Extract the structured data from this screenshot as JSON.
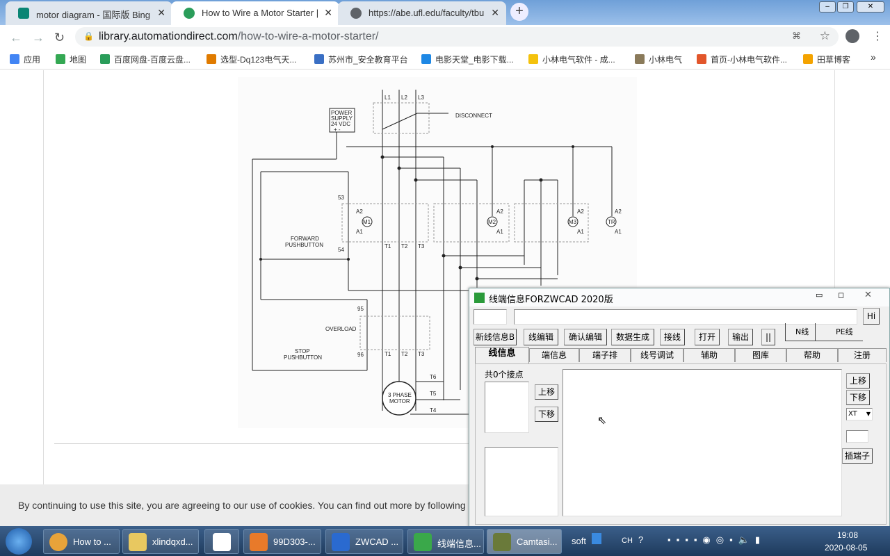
{
  "browser": {
    "tabs": [
      {
        "label": "motor diagram - 国际版 Bing",
        "icon": "bing-icon",
        "color": "#0a8574"
      },
      {
        "label": "How to Wire a Motor Starter |",
        "icon": "automationdirect-icon",
        "color": "#2a9d5a"
      },
      {
        "label": "https://abe.ufl.edu/faculty/tbu",
        "icon": "globe-icon",
        "color": "#5f6368"
      }
    ],
    "url_host": "library.automationdirect.com",
    "url_path": "/how-to-wire-a-motor-starter/",
    "bookmarks": [
      {
        "label": "应用",
        "color": "#4285f4"
      },
      {
        "label": "地图",
        "color": "#34a853"
      },
      {
        "label": "百度网盘-百度云盘...",
        "color": "#2a9d5a"
      },
      {
        "label": "选型-Dq123电气天...",
        "color": "#e07b00"
      },
      {
        "label": "苏州市_安全教育平台",
        "color": "#3a6fc4"
      },
      {
        "label": "电影天堂_电影下载...",
        "color": "#1e88e5"
      },
      {
        "label": "小林电气软件 - 成...",
        "color": "#f4c20d"
      },
      {
        "label": "小林电气",
        "color": "#8a7a5a"
      },
      {
        "label": "首页-小林电气软件...",
        "color": "#e2562b"
      },
      {
        "label": "田草博客",
        "color": "#f4a300"
      }
    ]
  },
  "diagram": {
    "phases": [
      "L1",
      "L2",
      "L3"
    ],
    "disconnect": "DISCONNECT",
    "power_supply": [
      "POWER",
      "SUPPLY",
      "24  VDC",
      "+   -"
    ],
    "n53": "53",
    "n54": "54",
    "n95": "95",
    "n96": "96",
    "a2": "A2",
    "a1": "A1",
    "coils": [
      "M1",
      "M2",
      "M3",
      "TR"
    ],
    "terminals": [
      "T1",
      "T2",
      "T3"
    ],
    "forward": [
      "FORWARD",
      "PUSHBUTTON"
    ],
    "stop": [
      "STOP",
      "PUSHBUTTON"
    ],
    "overload": "OVERLOAD",
    "motor": [
      "3 PHASE",
      "MOTOR"
    ],
    "motor_leads": [
      "T6",
      "T5",
      "T4"
    ]
  },
  "cookie_text": "By continuing to use this site, you are agreeing to our use of cookies. You can find out more by following",
  "dialog": {
    "title": "线端信息FORZWCAD 2020版",
    "hi": "Hi",
    "buttons": [
      "新线信息B",
      "线编辑",
      "确认编辑",
      "数据生成",
      "接线",
      "打开",
      "输出",
      "||"
    ],
    "n_label": "N线",
    "pe_label": "PE线",
    "tabs": [
      "线信息",
      "端信息",
      "端子排",
      "线号调试",
      "辅助",
      "图库",
      "帮助",
      "注册"
    ],
    "count_label": "共0个接点",
    "up": "上移",
    "down": "下移",
    "xt": "XT",
    "insert": "插端子"
  },
  "taskbar": {
    "items": [
      {
        "label": "How to ...",
        "color": "#e8a33a"
      },
      {
        "label": "xlindqxd...",
        "color": "#e8c860"
      },
      {
        "label": "",
        "color": "#fff"
      },
      {
        "label": "99D303-...",
        "color": "#e87a2a"
      },
      {
        "label": "ZWCAD ...",
        "color": "#2a6ad0"
      },
      {
        "label": "线端信息...",
        "color": "#3aa84a"
      },
      {
        "label": "Camtasi...",
        "color": "#6a7a3a"
      }
    ],
    "soft": "soft",
    "lang": "CH",
    "time": "19:08",
    "date": "2020-08-05"
  }
}
